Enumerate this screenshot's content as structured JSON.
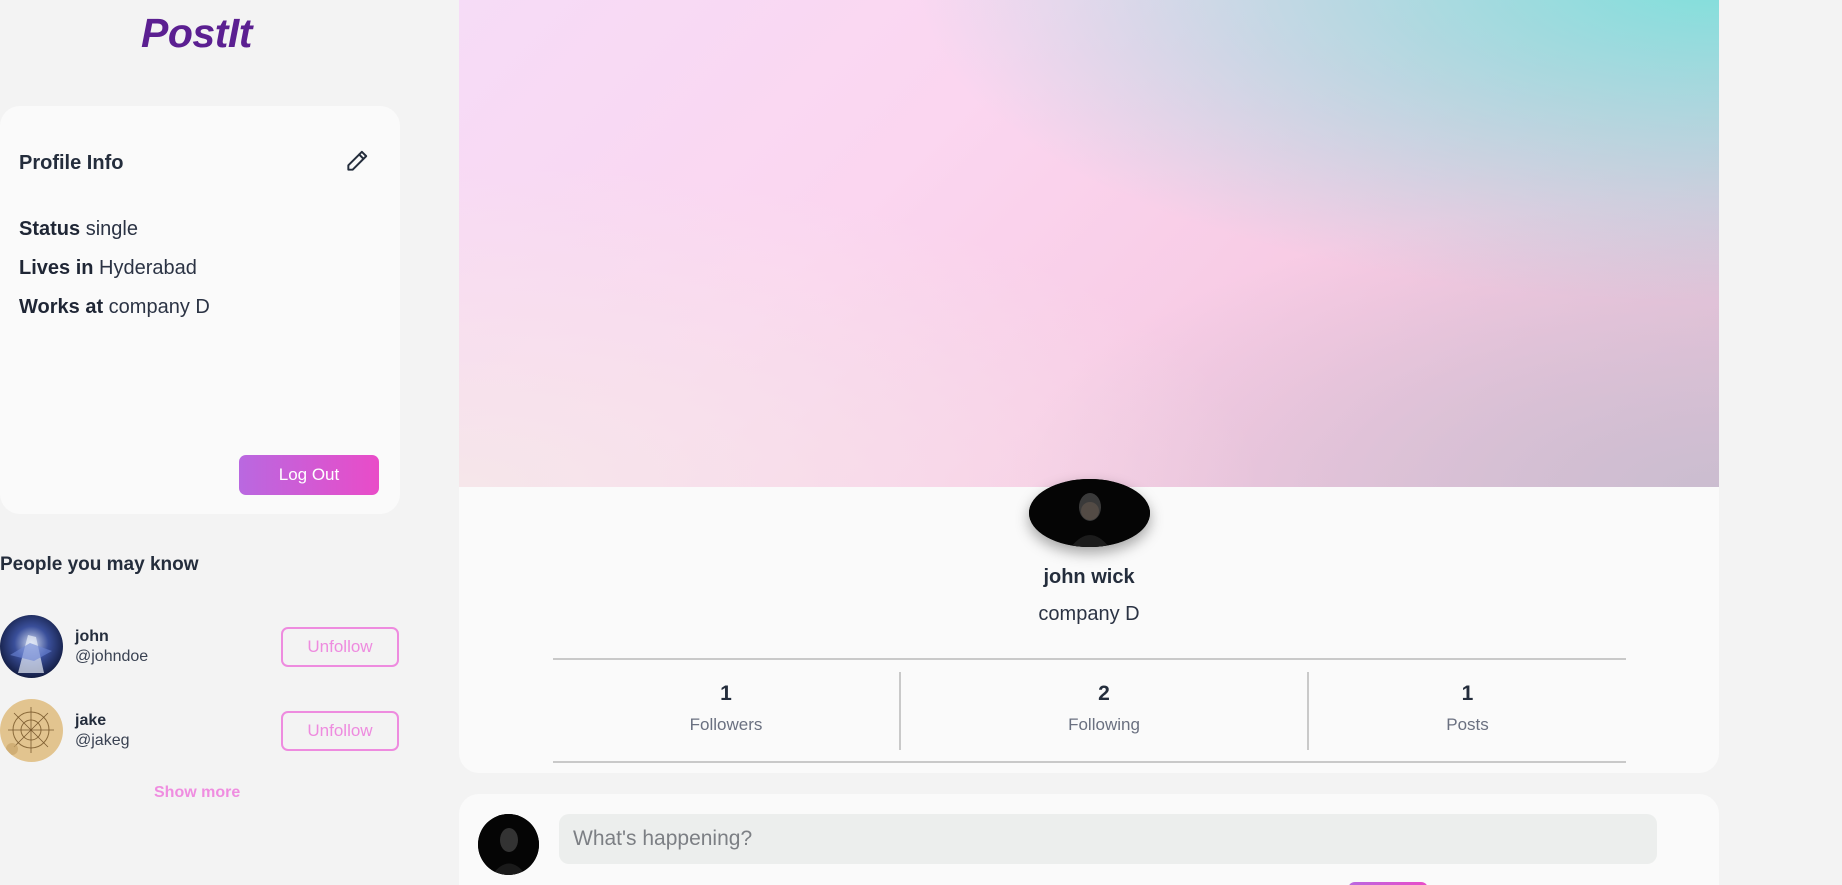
{
  "app": {
    "logo": "PostIt"
  },
  "profile_info": {
    "title": "Profile Info",
    "rows": [
      {
        "label": "Status",
        "value": "single"
      },
      {
        "label": "Lives in",
        "value": "Hyderabad"
      },
      {
        "label": "Works at",
        "value": "company D"
      }
    ],
    "logout_label": "Log Out"
  },
  "people": {
    "title": "People you may know",
    "items": [
      {
        "name": "john",
        "handle": "@johndoe",
        "action": "Unfollow"
      },
      {
        "name": "jake",
        "handle": "@jakeg",
        "action": "Unfollow"
      }
    ],
    "show_more": "Show more"
  },
  "user": {
    "name": "john wick",
    "company": "company D",
    "stats": [
      {
        "value": "1",
        "label": "Followers"
      },
      {
        "value": "2",
        "label": "Following"
      },
      {
        "value": "1",
        "label": "Posts"
      }
    ]
  },
  "composer": {
    "placeholder": "What's happening?"
  },
  "colors": {
    "brand": "#5b1f91",
    "accent_pink": "#ee8bdf",
    "gradient_start": "#b968e0",
    "gradient_end": "#e94cc8"
  }
}
